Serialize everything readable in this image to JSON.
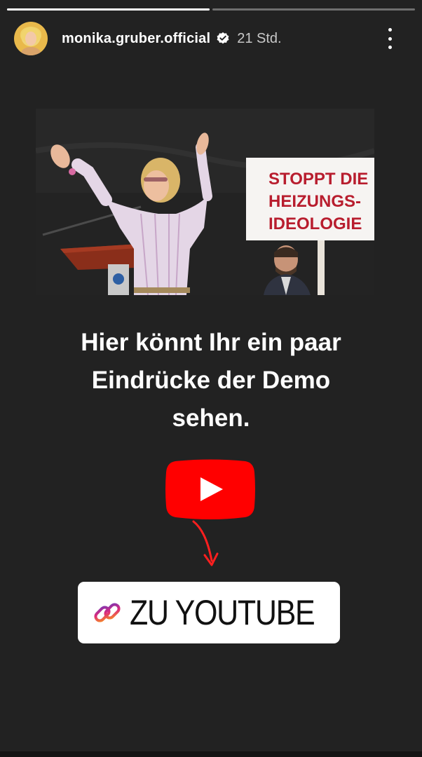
{
  "story": {
    "progress": [
      {
        "fraction": 1.0
      },
      {
        "fraction": 0.0
      }
    ]
  },
  "header": {
    "username": "monika.gruber.official",
    "verified_icon": "verified-badge-icon",
    "time": "21 Std.",
    "more_icon": "more-vertical-icon"
  },
  "photo": {
    "sign_lines": [
      "STOPPT DIE",
      "HEIZUNGS-",
      "IDEOLOGIE"
    ]
  },
  "headline": {
    "lines": [
      "Hier könnt Ihr ein paar",
      "Eindrücke der Demo",
      "sehen."
    ]
  },
  "youtube": {
    "icon": "youtube-play-icon",
    "color": "#ff0000",
    "arrow_icon": "arrow-down-icon"
  },
  "link_sticker": {
    "icon": "link-icon",
    "label": "ZU YOUTUBE"
  },
  "colors": {
    "background": "#222222",
    "link_gradient_start": "#f58529",
    "link_gradient_end": "#dd2a7b",
    "sign_text": "#b81d2e"
  }
}
